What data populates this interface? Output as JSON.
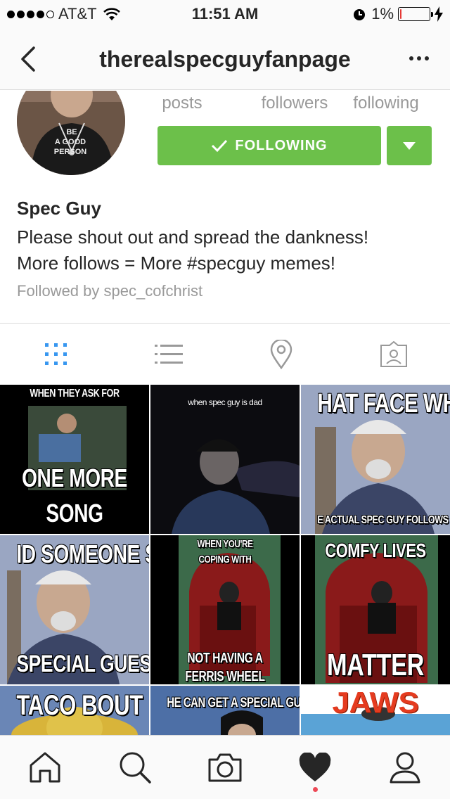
{
  "status_bar": {
    "carrier": "AT&T",
    "time": "11:51 AM",
    "battery_percent": "1%",
    "battery_level": 0.03
  },
  "nav": {
    "title": "therealspecguyfanpage"
  },
  "profile": {
    "stats": [
      {
        "label": "posts"
      },
      {
        "label": "followers"
      },
      {
        "label": "following"
      }
    ],
    "following_label": "FOLLOWING",
    "display_name": "Spec Guy",
    "bio_line1": "Please shout out and spread the dankness!",
    "bio_line2": "More follows = More #specguy memes!",
    "followed_by": "Followed by spec_cofchrist",
    "avatar_shirt_text": [
      "BE",
      "A GOOD",
      "PERSON"
    ]
  },
  "tabs": [
    "grid-icon",
    "list-icon",
    "location-pin-icon",
    "tagged-icon"
  ],
  "grid": {
    "posts": [
      {
        "top": "WHEN THEY ASK FOR",
        "bottom1": "ONE MORE",
        "bottom2": "SONG"
      },
      {
        "top": "when spec guy is dad"
      },
      {
        "top": "HAT FACE WHE",
        "bottom": "E ACTUAL SPEC GUY FOLLOWS Y"
      },
      {
        "top": "ID SOMEONE SAY",
        "bottom": "SPECIAL GUESTS?"
      },
      {
        "top1": "WHEN YOU'RE",
        "top2": "COPING WITH",
        "bottom1": "NOT HAVING A",
        "bottom2": "FERRIS WHEEL"
      },
      {
        "top": "COMFY LIVES",
        "bottom": "MATTER"
      },
      {
        "top": "TACO BOUT"
      },
      {
        "top": "HE CAN GET A SPECIAL GUEST"
      },
      {
        "top": "JAWS"
      }
    ]
  },
  "bottom_nav": [
    "home-icon",
    "search-icon",
    "camera-icon",
    "heart-icon",
    "profile-icon"
  ],
  "colors": {
    "follow_green": "#6cc04a",
    "accent_blue": "#3897f0",
    "notif_red": "#ed4956"
  }
}
